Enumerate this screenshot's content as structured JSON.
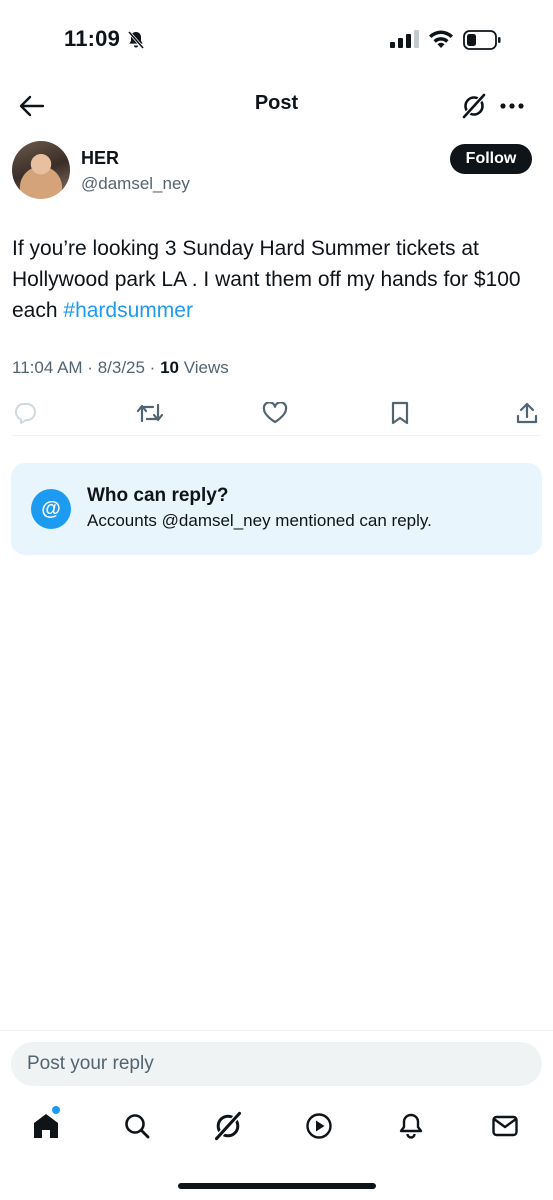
{
  "status_bar": {
    "time": "11:09"
  },
  "header": {
    "title": "Post"
  },
  "author": {
    "name": "HER",
    "handle": "@damsel_ney",
    "follow_label": "Follow"
  },
  "post": {
    "text": "If you’re looking 3 Sunday Hard Summer tickets at Hollywood park LA . I want them off my hands for $100 each",
    "hashtag": "#hardsummer",
    "time": "11:04 AM",
    "date": "8/3/25",
    "views_count": "10",
    "views_label": "Views"
  },
  "reply_restriction": {
    "title": "Who can reply?",
    "description": "Accounts @damsel_ney mentioned can reply."
  },
  "composer": {
    "placeholder": "Post your reply"
  },
  "icons": {
    "status": [
      "bell-off-icon",
      "signal-icon",
      "wifi-icon",
      "battery-icon"
    ],
    "header": [
      "back-arrow-icon",
      "grok-icon",
      "more-icon"
    ],
    "actions": [
      "reply-icon",
      "repost-icon",
      "like-icon",
      "bookmark-icon",
      "share-icon"
    ],
    "nav": [
      "home-icon",
      "search-icon",
      "grok-icon",
      "video-icon",
      "notifications-icon",
      "messages-icon"
    ]
  },
  "colors": {
    "accent": "#1d9bf0",
    "text": "#0f1419",
    "secondary": "#536471",
    "card_bg": "#e8f5fd"
  }
}
